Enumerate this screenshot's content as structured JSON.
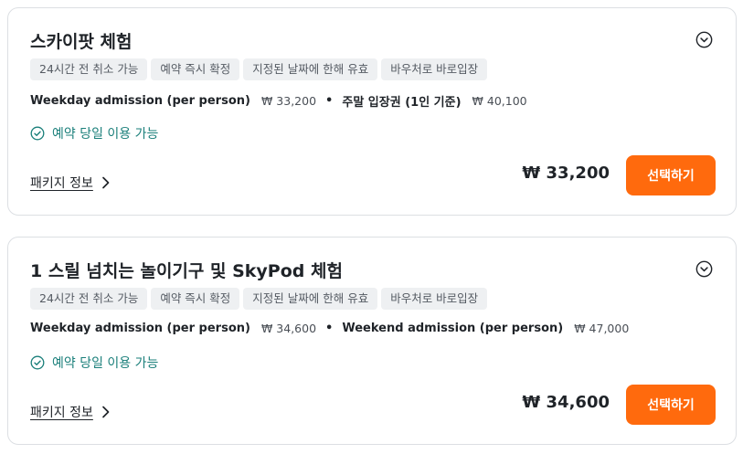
{
  "colors": {
    "accent": "#ff6a0d",
    "available": "#1a7f7a",
    "tag_bg": "#eef0f2"
  },
  "packages": [
    {
      "title": "스카이팟 체험",
      "tags": [
        "24시간 전 취소 가능",
        "예약 즉시 확정",
        "지정된 날짜에 한해 유효",
        "바우처로 바로입장"
      ],
      "options": [
        {
          "name": "Weekday admission (per person)",
          "price": "₩ 33,200"
        },
        {
          "name": "주말 입장권 (1인 기준)",
          "price": "₩ 40,100"
        }
      ],
      "availability": "예약 당일 이용 가능",
      "details_link": "패키지 정보",
      "total_price": "₩ 33,200",
      "select_label": "선택하기",
      "expand_icon": "chevron-down-circle-icon"
    },
    {
      "title": "1 스릴 넘치는 놀이기구 및 SkyPod 체험",
      "tags": [
        "24시간 전 취소 가능",
        "예약 즉시 확정",
        "지정된 날짜에 한해 유효",
        "바우처로 바로입장"
      ],
      "options": [
        {
          "name": "Weekday admission (per person)",
          "price": "₩ 34,600"
        },
        {
          "name": "Weekend admission (per person)",
          "price": "₩ 47,000"
        }
      ],
      "availability": "예약 당일 이용 가능",
      "details_link": "패키지 정보",
      "total_price": "₩ 34,600",
      "select_label": "선택하기",
      "expand_icon": "chevron-down-circle-icon"
    }
  ]
}
